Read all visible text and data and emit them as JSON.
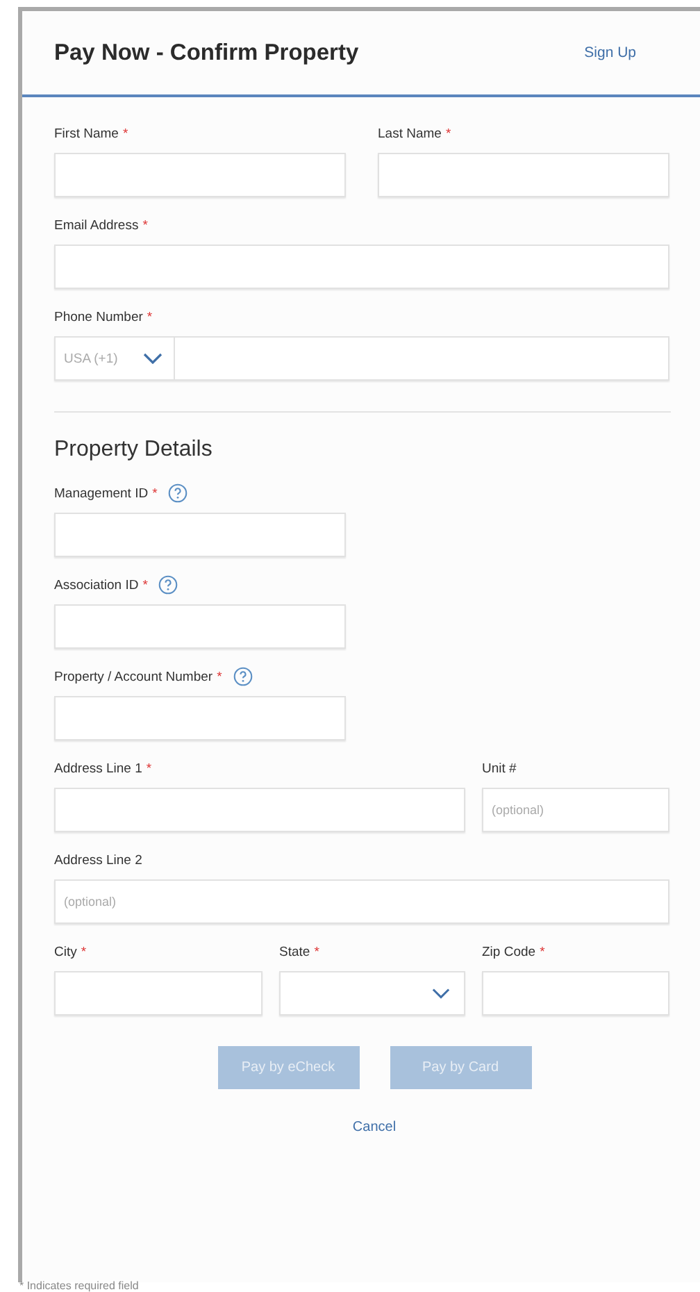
{
  "header": {
    "title": "Pay Now - Confirm Property",
    "link": "Sign Up"
  },
  "required_mark": "*",
  "sections": [
    {
      "rows": [
        {
          "kind": "halves",
          "fields": [
            {
              "label": "First Name",
              "required": true,
              "kind": "text"
            },
            {
              "label": "Last Name",
              "required": true,
              "kind": "text"
            }
          ]
        },
        {
          "kind": "full",
          "fields": [
            {
              "label": "Email Address",
              "required": true,
              "kind": "text"
            }
          ]
        },
        {
          "kind": "full",
          "fields": [
            {
              "label": "Phone Number",
              "required": true,
              "kind": "phone",
              "country": "USA (+1)"
            }
          ]
        }
      ]
    },
    {
      "heading": "Property Details",
      "rows": [
        {
          "kind": "half",
          "fields": [
            {
              "label": "Management ID",
              "required": true,
              "help": true,
              "kind": "text"
            }
          ]
        },
        {
          "kind": "half",
          "fields": [
            {
              "label": "Association ID",
              "required": true,
              "help": true,
              "kind": "text"
            }
          ]
        },
        {
          "kind": "half",
          "fields": [
            {
              "label": "Property / Account Number",
              "required": true,
              "help": true,
              "kind": "text"
            }
          ]
        },
        {
          "kind": "wide-narrow",
          "fields": [
            {
              "label": "Address Line 1",
              "required": true,
              "kind": "text"
            },
            {
              "label": "Unit #",
              "required": false,
              "kind": "text",
              "placeholder": "(optional)"
            }
          ]
        },
        {
          "kind": "full",
          "fields": [
            {
              "label": "Address Line 2",
              "required": false,
              "kind": "text",
              "placeholder": "(optional)"
            }
          ]
        },
        {
          "kind": "thirds",
          "fields": [
            {
              "label": "City",
              "required": true,
              "kind": "text"
            },
            {
              "label": "State",
              "required": true,
              "kind": "select"
            },
            {
              "label": "Zip Code",
              "required": true,
              "kind": "text"
            }
          ]
        }
      ]
    }
  ],
  "buttons": [
    {
      "label": "Pay by eCheck",
      "disabled": true
    },
    {
      "label": "Pay by Card",
      "disabled": true
    }
  ],
  "cancel": "Cancel",
  "footnote": "* Indicates required field"
}
